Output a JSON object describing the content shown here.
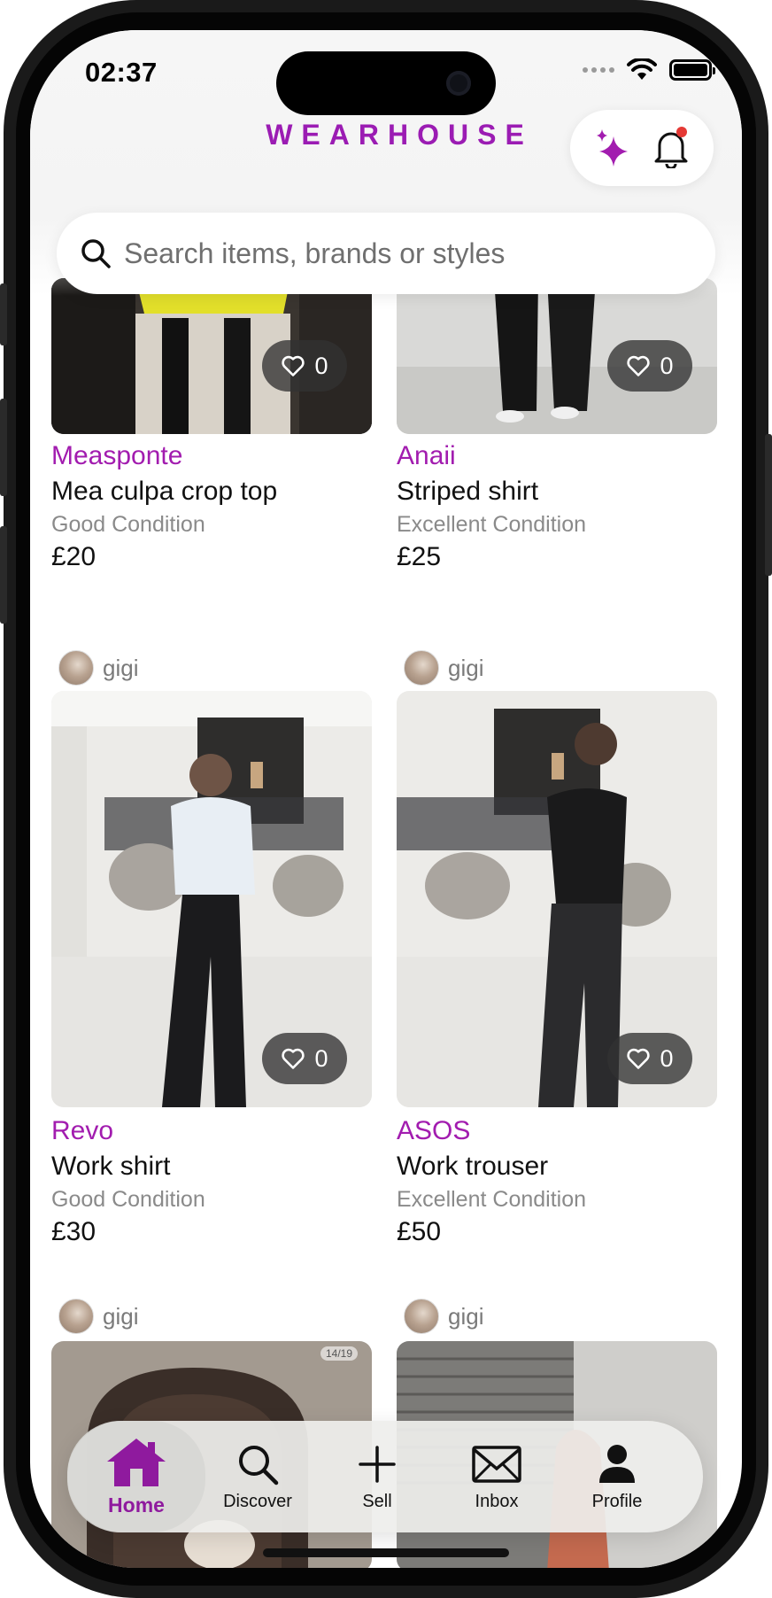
{
  "status_bar": {
    "time": "02:37"
  },
  "header": {
    "brand": "WEARHOUSE"
  },
  "search": {
    "placeholder": "Search items, brands or styles"
  },
  "listings": [
    {
      "brand": "Measponte",
      "title": "Mea culpa crop top",
      "condition": "Good Condition",
      "price": "£20",
      "likes": "0"
    },
    {
      "brand": "Anaii",
      "title": "Striped shirt",
      "condition": "Excellent Condition",
      "price": "£25",
      "likes": "0"
    },
    {
      "seller": "gigi",
      "brand": "Revo",
      "title": "Work shirt",
      "condition": "Good Condition",
      "price": "£30",
      "likes": "0"
    },
    {
      "seller": "gigi",
      "brand": "ASOS",
      "title": "Work trouser",
      "condition": "Excellent Condition",
      "price": "£50",
      "likes": "0"
    },
    {
      "seller": "gigi",
      "photo_badge": "14/19"
    },
    {
      "seller": "gigi"
    }
  ],
  "tabbar": {
    "items": [
      {
        "label": "Home",
        "icon": "home-icon",
        "active": true
      },
      {
        "label": "Discover",
        "icon": "search-icon"
      },
      {
        "label": "Sell",
        "icon": "plus-icon"
      },
      {
        "label": "Inbox",
        "icon": "mail-icon"
      },
      {
        "label": "Profile",
        "icon": "person-icon"
      }
    ]
  },
  "colors": {
    "brand": "#9b1cb3",
    "notification_dot": "#e53935"
  }
}
